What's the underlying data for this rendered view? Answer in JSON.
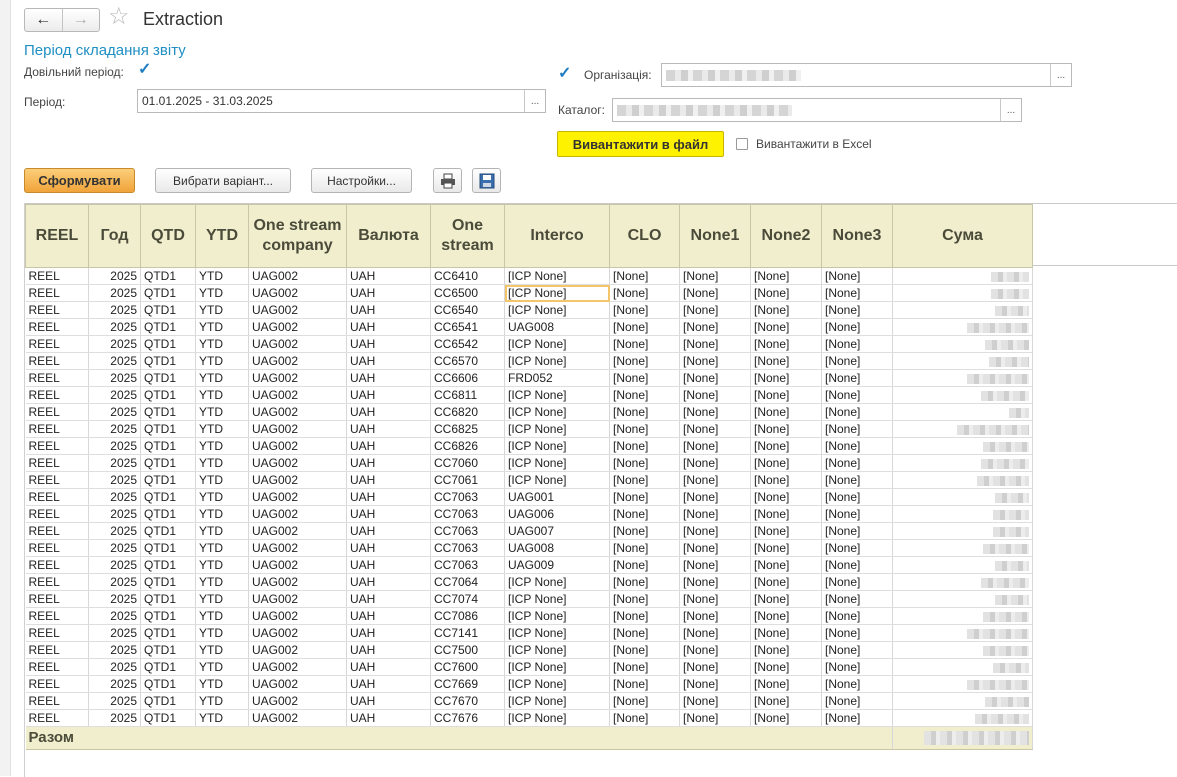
{
  "window": {
    "title": "Extraction"
  },
  "nav": {
    "back": "←",
    "forward": "→",
    "favorite": "☆"
  },
  "period_section": {
    "title": "Період складання звіту",
    "custom_period_label": "Довільний період:",
    "custom_period_checked": true,
    "period_label": "Період:",
    "period_value": "01.01.2025 - 31.03.2025",
    "select_btn": "..."
  },
  "filters": {
    "org_checked": true,
    "org_label": "Організація:",
    "catalog_label": "Каталог:",
    "select_btn": "..."
  },
  "export": {
    "to_file_label": "Вивантажити в файл",
    "to_excel_label": "Вивантажити в Excel",
    "to_excel_checked": false
  },
  "toolbar": {
    "generate_label": "Сформувати",
    "choose_variant_label": "Вибрати варіант...",
    "settings_label": "Настройки...",
    "print_icon": "print-icon",
    "save_icon": "save-icon"
  },
  "table": {
    "headers": [
      "REEL",
      "Год",
      "QTD",
      "YTD",
      "One stream company",
      "Валюта",
      "One stream",
      "Interco",
      "CLO",
      "None1",
      "None2",
      "None3",
      "Сума"
    ],
    "rows": [
      [
        "REEL",
        "2025",
        "QTD1",
        "YTD",
        "UAG002",
        "UAH",
        "CC6410",
        "[ICP None]",
        "[None]",
        "[None]",
        "[None]",
        "[None]"
      ],
      [
        "REEL",
        "2025",
        "QTD1",
        "YTD",
        "UAG002",
        "UAH",
        "CC6500",
        "[ICP None]",
        "[None]",
        "[None]",
        "[None]",
        "[None]"
      ],
      [
        "REEL",
        "2025",
        "QTD1",
        "YTD",
        "UAG002",
        "UAH",
        "CC6540",
        "[ICP None]",
        "[None]",
        "[None]",
        "[None]",
        "[None]"
      ],
      [
        "REEL",
        "2025",
        "QTD1",
        "YTD",
        "UAG002",
        "UAH",
        "CC6541",
        "UAG008",
        "[None]",
        "[None]",
        "[None]",
        "[None]"
      ],
      [
        "REEL",
        "2025",
        "QTD1",
        "YTD",
        "UAG002",
        "UAH",
        "CC6542",
        "[ICP None]",
        "[None]",
        "[None]",
        "[None]",
        "[None]"
      ],
      [
        "REEL",
        "2025",
        "QTD1",
        "YTD",
        "UAG002",
        "UAH",
        "CC6570",
        "[ICP None]",
        "[None]",
        "[None]",
        "[None]",
        "[None]"
      ],
      [
        "REEL",
        "2025",
        "QTD1",
        "YTD",
        "UAG002",
        "UAH",
        "CC6606",
        "FRD052",
        "[None]",
        "[None]",
        "[None]",
        "[None]"
      ],
      [
        "REEL",
        "2025",
        "QTD1",
        "YTD",
        "UAG002",
        "UAH",
        "CC6811",
        "[ICP None]",
        "[None]",
        "[None]",
        "[None]",
        "[None]"
      ],
      [
        "REEL",
        "2025",
        "QTD1",
        "YTD",
        "UAG002",
        "UAH",
        "CC6820",
        "[ICP None]",
        "[None]",
        "[None]",
        "[None]",
        "[None]"
      ],
      [
        "REEL",
        "2025",
        "QTD1",
        "YTD",
        "UAG002",
        "UAH",
        "CC6825",
        "[ICP None]",
        "[None]",
        "[None]",
        "[None]",
        "[None]"
      ],
      [
        "REEL",
        "2025",
        "QTD1",
        "YTD",
        "UAG002",
        "UAH",
        "CC6826",
        "[ICP None]",
        "[None]",
        "[None]",
        "[None]",
        "[None]"
      ],
      [
        "REEL",
        "2025",
        "QTD1",
        "YTD",
        "UAG002",
        "UAH",
        "CC7060",
        "[ICP None]",
        "[None]",
        "[None]",
        "[None]",
        "[None]"
      ],
      [
        "REEL",
        "2025",
        "QTD1",
        "YTD",
        "UAG002",
        "UAH",
        "CC7061",
        "[ICP None]",
        "[None]",
        "[None]",
        "[None]",
        "[None]"
      ],
      [
        "REEL",
        "2025",
        "QTD1",
        "YTD",
        "UAG002",
        "UAH",
        "CC7063",
        "UAG001",
        "[None]",
        "[None]",
        "[None]",
        "[None]"
      ],
      [
        "REEL",
        "2025",
        "QTD1",
        "YTD",
        "UAG002",
        "UAH",
        "CC7063",
        "UAG006",
        "[None]",
        "[None]",
        "[None]",
        "[None]"
      ],
      [
        "REEL",
        "2025",
        "QTD1",
        "YTD",
        "UAG002",
        "UAH",
        "CC7063",
        "UAG007",
        "[None]",
        "[None]",
        "[None]",
        "[None]"
      ],
      [
        "REEL",
        "2025",
        "QTD1",
        "YTD",
        "UAG002",
        "UAH",
        "CC7063",
        "UAG008",
        "[None]",
        "[None]",
        "[None]",
        "[None]"
      ],
      [
        "REEL",
        "2025",
        "QTD1",
        "YTD",
        "UAG002",
        "UAH",
        "CC7063",
        "UAG009",
        "[None]",
        "[None]",
        "[None]",
        "[None]"
      ],
      [
        "REEL",
        "2025",
        "QTD1",
        "YTD",
        "UAG002",
        "UAH",
        "CC7064",
        "[ICP None]",
        "[None]",
        "[None]",
        "[None]",
        "[None]"
      ],
      [
        "REEL",
        "2025",
        "QTD1",
        "YTD",
        "UAG002",
        "UAH",
        "CC7074",
        "[ICP None]",
        "[None]",
        "[None]",
        "[None]",
        "[None]"
      ],
      [
        "REEL",
        "2025",
        "QTD1",
        "YTD",
        "UAG002",
        "UAH",
        "CC7086",
        "[ICP None]",
        "[None]",
        "[None]",
        "[None]",
        "[None]"
      ],
      [
        "REEL",
        "2025",
        "QTD1",
        "YTD",
        "UAG002",
        "UAH",
        "CC7141",
        "[ICP None]",
        "[None]",
        "[None]",
        "[None]",
        "[None]"
      ],
      [
        "REEL",
        "2025",
        "QTD1",
        "YTD",
        "UAG002",
        "UAH",
        "CC7500",
        "[ICP None]",
        "[None]",
        "[None]",
        "[None]",
        "[None]"
      ],
      [
        "REEL",
        "2025",
        "QTD1",
        "YTD",
        "UAG002",
        "UAH",
        "CC7600",
        "[ICP None]",
        "[None]",
        "[None]",
        "[None]",
        "[None]"
      ],
      [
        "REEL",
        "2025",
        "QTD1",
        "YTD",
        "UAG002",
        "UAH",
        "CC7669",
        "[ICP None]",
        "[None]",
        "[None]",
        "[None]",
        "[None]"
      ],
      [
        "REEL",
        "2025",
        "QTD1",
        "YTD",
        "UAG002",
        "UAH",
        "CC7670",
        "[ICP None]",
        "[None]",
        "[None]",
        "[None]",
        "[None]"
      ],
      [
        "REEL",
        "2025",
        "QTD1",
        "YTD",
        "UAG002",
        "UAH",
        "CC7676",
        "[ICP None]",
        "[None]",
        "[None]",
        "[None]",
        "[None]"
      ]
    ],
    "total_label": "Разом"
  },
  "colors": {
    "accent_link": "#1f8fc4",
    "header_bg": "#f0eecd",
    "export_btn": "#fff200",
    "generate_btn": "#f1a33a"
  }
}
